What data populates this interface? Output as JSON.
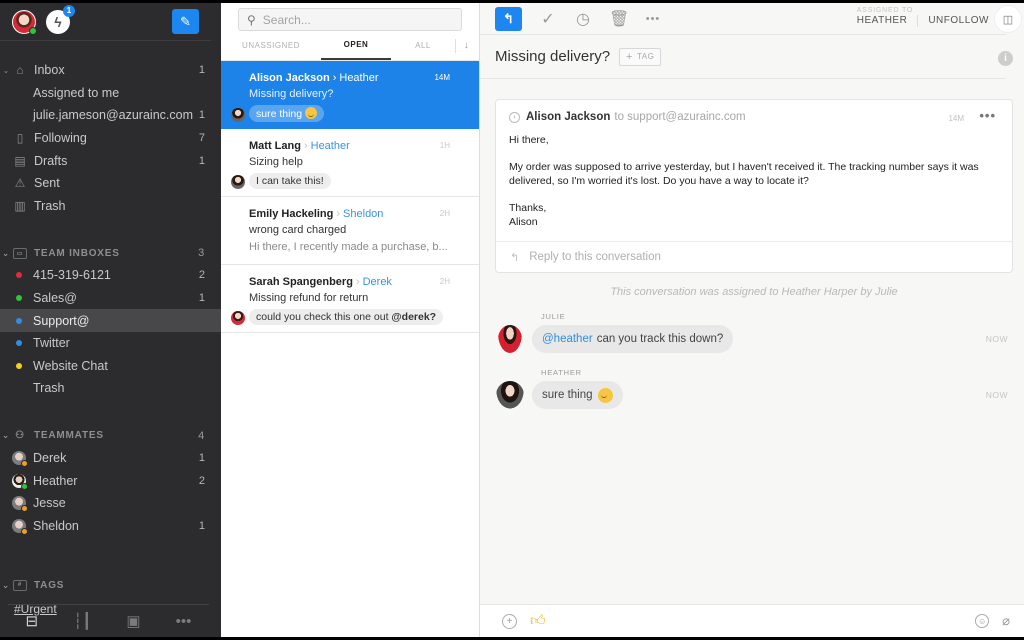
{
  "sidebar": {
    "notification_count": "1",
    "inbox": {
      "label": "Inbox",
      "count": "1",
      "children": [
        {
          "label": "Assigned to me",
          "count": ""
        },
        {
          "label": "julie.jameson@azurainc.com",
          "count": "1"
        }
      ]
    },
    "items": [
      {
        "label": "Following",
        "count": "7",
        "icon": "bookmark-icon"
      },
      {
        "label": "Drafts",
        "count": "1",
        "icon": "drafts-icon"
      },
      {
        "label": "Sent",
        "count": "",
        "icon": "sent-icon"
      },
      {
        "label": "Trash",
        "count": "",
        "icon": "trash-icon"
      }
    ],
    "team_inboxes": {
      "title": "TEAM INBOXES",
      "count": "3",
      "items": [
        {
          "label": "415-319-6121",
          "count": "2",
          "color": "#e5293a"
        },
        {
          "label": "Sales@",
          "count": "1",
          "color": "#2ec63a"
        },
        {
          "label": "Support@",
          "count": "",
          "color": "#2f8ee6",
          "active": true
        },
        {
          "label": "Twitter",
          "count": "",
          "color": "#2f8ee6"
        },
        {
          "label": "Website Chat",
          "count": "",
          "color": "#f3d21e"
        },
        {
          "label": "Trash",
          "count": ""
        }
      ]
    },
    "teammates": {
      "title": "TEAMMATES",
      "count": "4",
      "items": [
        {
          "label": "Derek",
          "count": "1",
          "status": "#f0a020"
        },
        {
          "label": "Heather",
          "count": "2",
          "status": "#2ec63a"
        },
        {
          "label": "Jesse",
          "count": "",
          "status": "#f0a020"
        },
        {
          "label": "Sheldon",
          "count": "1",
          "status": "#f0a020"
        }
      ]
    },
    "tags": {
      "title": "TAGS",
      "items": [
        "#Urgent"
      ]
    },
    "bottom_nav": [
      "inbox-tray-icon",
      "analytics-icon",
      "contacts-icon",
      "more-icon"
    ]
  },
  "list": {
    "search_placeholder": "Search...",
    "tabs": [
      "UNASSIGNED",
      "OPEN",
      "ALL"
    ],
    "active_tab": "OPEN",
    "conversations": [
      {
        "from": "Alison Jackson",
        "to": "Heather",
        "time": "14M",
        "subject": "Missing delivery?",
        "comment": "sure thing",
        "has_emoji": true,
        "selected": true
      },
      {
        "from": "Matt Lang",
        "to": "Heather",
        "time": "1H",
        "subject": "Sizing help",
        "comment": "I can take this!"
      },
      {
        "from": "Emily Hackeling",
        "to": "Sheldon",
        "time": "2H",
        "subject": "wrong card charged",
        "preview": "Hi there, I recently made a purchase, b..."
      },
      {
        "from": "Sarah Spangenberg",
        "to": "Derek",
        "time": "2H",
        "subject": "Missing refund for return",
        "comment": "could you check this one out ",
        "comment_mention": "@derek?"
      }
    ]
  },
  "main": {
    "toolbar": {
      "assigned_caption": "ASSIGNED TO",
      "assignee": "HEATHER",
      "unfollow": "UNFOLLOW"
    },
    "title": "Missing delivery?",
    "tag_button": "TAG",
    "message": {
      "sender": "Alison Jackson",
      "recipient": "to support@azurainc.com",
      "time": "14M",
      "greeting": "Hi there,",
      "body": "My order was supposed to arrive yesterday, but I haven't received it. The tracking number says it was delivered, so I'm worried it's lost. Do you have a way to locate it?",
      "signoff": "Thanks,",
      "signature": "Alison"
    },
    "reply_placeholder": "Reply to this conversation",
    "assignment_note": "This conversation was assigned to Heather Harper by Julie",
    "comments": [
      {
        "author": "JULIE",
        "mention": "@heather",
        "text": "can you track this down?",
        "time": "NOW"
      },
      {
        "author": "HEATHER",
        "text": "sure thing",
        "has_emoji": true,
        "time": "NOW"
      }
    ]
  }
}
